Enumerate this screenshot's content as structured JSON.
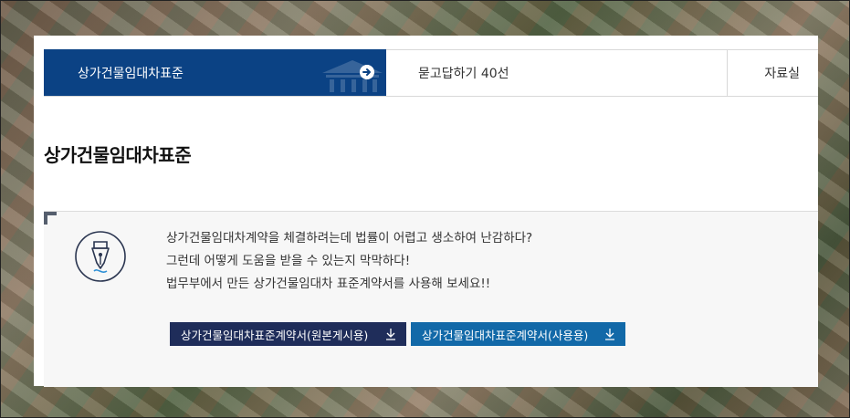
{
  "tabs": [
    {
      "label": "상가건물임대차표준",
      "active": true
    },
    {
      "label": "묻고답하기 40선",
      "active": false
    },
    {
      "label": "자료실",
      "active": false
    }
  ],
  "page_title": "상가건물임대차표준",
  "info": {
    "lines": [
      "상가건물임대차계약을 체결하려는데 법률이 어렵고 생소하여 난감하다?",
      "그런데 어떻게 도움을 받을 수 있는지 막막하다!",
      "법무부에서 만든 상가건물임대차 표준계약서를 사용해 보세요!!"
    ],
    "buttons": [
      {
        "label": "상가건물임대차표준계약서(원본게시용)"
      },
      {
        "label": "상가건물임대차표준계약서(사용용)"
      }
    ]
  },
  "colors": {
    "active_tab": "#0b4284",
    "button_dark": "#1f2d5a",
    "button_blue": "#1269a8",
    "info_bg": "#f7f7f7"
  },
  "icons": [
    "bank-icon",
    "arrow-right-circle-icon",
    "fountain-pen-icon",
    "download-icon"
  ]
}
